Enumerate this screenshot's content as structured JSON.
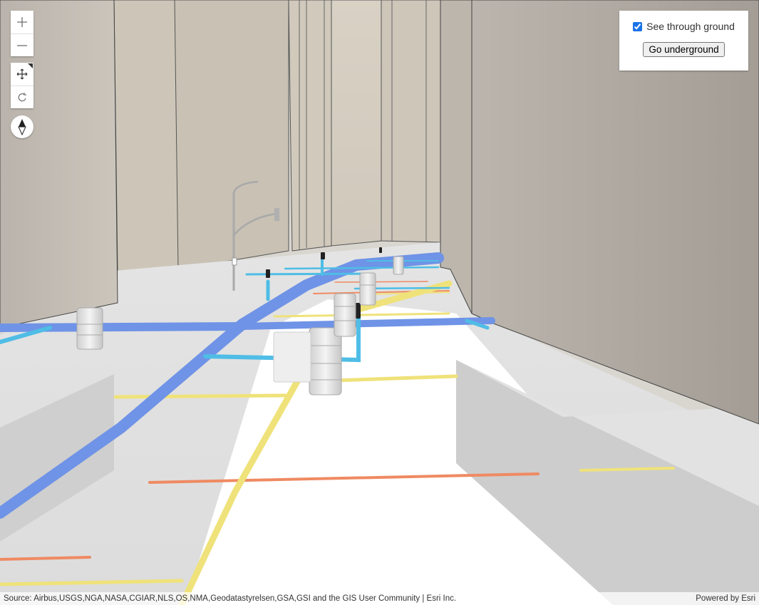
{
  "widgets": {
    "zoom_in_icon": "plus-icon",
    "zoom_out_icon": "minus-icon",
    "pan_icon": "move-arrows-icon",
    "rotate_icon": "rotate-icon",
    "compass_icon": "compass-icon"
  },
  "panel": {
    "see_through_label": "See through ground",
    "see_through_checked": true,
    "go_underground_label": "Go underground"
  },
  "attribution": {
    "source": "Source: Airbus,USGS,NGA,NASA,CGIAR,NLS,OS,NMA,Geodatastyrelsen,GSA,GSI and the GIS User Community | Esri Inc.",
    "powered_by": "Powered by Esri"
  },
  "colors": {
    "water_main": "#6f93e6",
    "service_line": "#4fbde6",
    "gas_line": "#efe27a",
    "electric_line": "#ef8a62",
    "building": "#c9c2b6",
    "ground": "#f4f4f4"
  }
}
